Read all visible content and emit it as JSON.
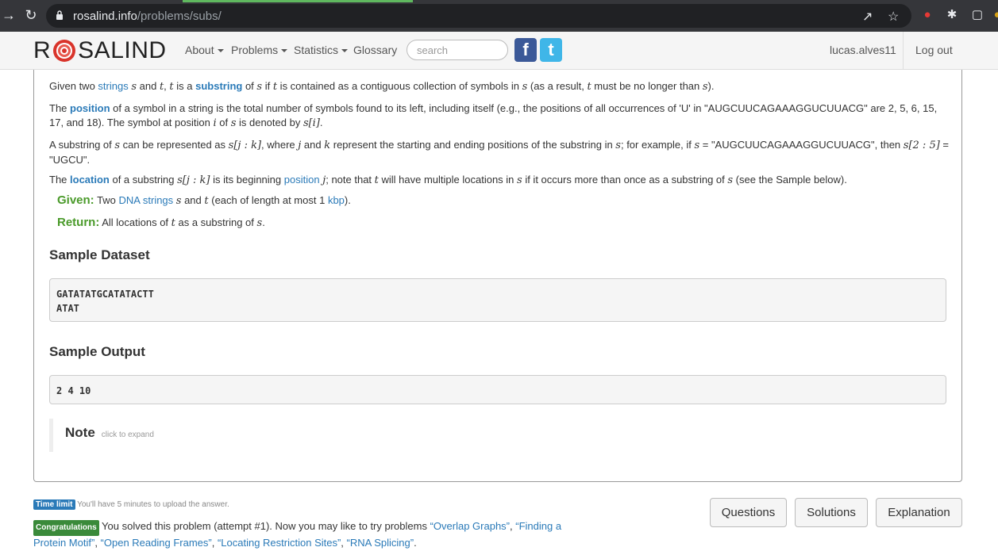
{
  "browser": {
    "url_host": "rosalind.info",
    "url_path": "/problems/subs/"
  },
  "navbar": {
    "logo_left": "R",
    "logo_right": "SALIND",
    "items": [
      {
        "label": "About"
      },
      {
        "label": "Problems"
      },
      {
        "label": "Statistics"
      },
      {
        "label": "Glossary"
      }
    ],
    "search_placeholder": "search",
    "username": "lucas.alves11",
    "logout": "Log out"
  },
  "problem": {
    "p1": {
      "a": "Given two ",
      "strings": "strings",
      "b": " and ",
      "c": ", ",
      "d": " is a ",
      "substring": "substring",
      "e": " of ",
      "f": " if ",
      "g": " is contained as a contiguous collection of symbols in ",
      "h": " (as a result, ",
      "i": " must be no longer than ",
      "j": ")."
    },
    "p2": {
      "a": "The ",
      "position": "position",
      "b": " of a symbol in a string is the total number of symbols found to its left, including itself (e.g., the positions of all occurrences of 'U' in \"AUGCUUCAGAAAGGUCUUACG\" are 2, 5, 6, 15, 17, and 18). The symbol at position ",
      "c": " of ",
      "d": " is denoted by "
    },
    "p3": {
      "a": "A substring of ",
      "b": " can be represented as ",
      "c": ", where ",
      "d": " and ",
      "e": " represent the starting and ending positions of the substring in ",
      "f": "; for example, if ",
      "g": " = \"AUGCUUCAGAAAGGUCUUACG\", then ",
      "h": " = \"UGCU\"."
    },
    "p4": {
      "a": "The ",
      "location": "location",
      "b": " of a substring ",
      "c": " is its beginning ",
      "position": "position",
      "d": "; note that ",
      "e": " will have multiple locations in ",
      "f": " if it occurs more than once as a substring of ",
      "g": " (see the Sample below)."
    },
    "math": {
      "s": "s",
      "t": "t",
      "i": "i",
      "j": "j",
      "k": "k",
      "s_i": "s[i]",
      "s_jk": "s[j : k]",
      "s_25": "s[2 : 5]"
    },
    "given": {
      "label": "Given:",
      "a": " Two ",
      "dna": "DNA strings",
      "b": " and ",
      "c": " (each of length at most 1 ",
      "kbp": "kbp",
      "d": ")."
    },
    "return": {
      "label": "Return:",
      "a": " All locations of ",
      "b": " as a substring of ",
      "c": "."
    },
    "sample_dataset_title": "Sample Dataset",
    "sample_dataset_line1": "GATATATGCATATACTT",
    "sample_dataset_line2": "ATAT",
    "sample_output_title": "Sample Output",
    "sample_output": "2 4 10",
    "note_title": "Note",
    "note_hint": "click to expand"
  },
  "footer": {
    "time_limit_label": "Time limit",
    "time_limit_text": " You'll have 5 minutes to upload the answer.",
    "congrats_label": "Congratulations",
    "congrats_text": " You solved this problem (attempt #1). Now you may like to try problems ",
    "next_problems": [
      "“Overlap Graphs”",
      "“Finding a Protein Motif”",
      "“Open Reading Frames”",
      "“Locating Restriction Sites”",
      "“RNA Splicing”"
    ],
    "buttons": {
      "questions": "Questions",
      "solutions": "Solutions",
      "explanation": "Explanation"
    }
  }
}
